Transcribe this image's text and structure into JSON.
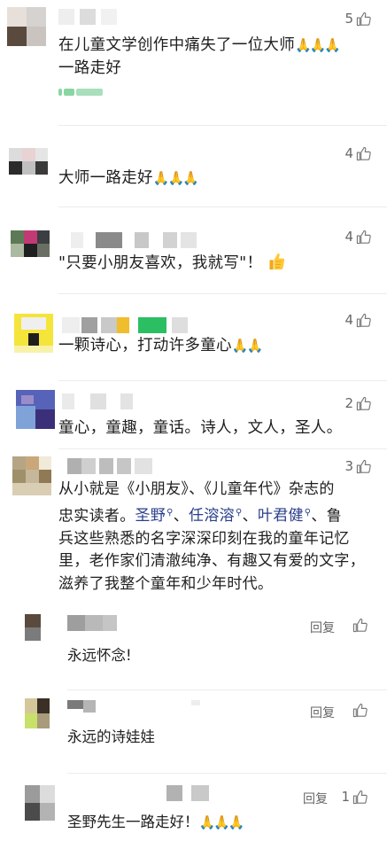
{
  "comments": [
    {
      "likes": "5",
      "text_lines": [
        "在儿童文学创作中痛失了一位大师",
        "一路走好"
      ],
      "emoji": "🙏🙏🙏"
    },
    {
      "likes": "4",
      "text": "大师一路走好",
      "emoji": "🙏🙏🙏"
    },
    {
      "likes": "4",
      "text": "\"只要小朋友喜欢，我就写\"！",
      "emoji": "👍"
    },
    {
      "likes": "4",
      "text": "一颗诗心，打动许多童心",
      "emoji": "🙏🙏"
    },
    {
      "likes": "2",
      "text": "童心，童趣，童话。诗人，文人，圣人。"
    },
    {
      "likes": "3",
      "line1": "从小就是《小朋友》、《儿童年代》杂志的",
      "line2_pre": "忠实读者。",
      "links": [
        "圣野",
        "任溶溶",
        "叶君健"
      ],
      "sep": "、",
      "line2_post": "、鲁",
      "line3": "兵这些熟悉的名字深深印刻在我的童年记忆",
      "line4": "里，老作家们清澈纯净、有趣又有爱的文字，",
      "line5": "滋养了我整个童年和少年时代。"
    }
  ],
  "replies": [
    {
      "reply_label": "回复",
      "text": "永远怀念!"
    },
    {
      "reply_label": "回复",
      "text": "永远的诗娃娃"
    },
    {
      "reply_label": "回复",
      "likes": "1",
      "text": "圣野先生一路走好！",
      "emoji": "🙏🙏🙏"
    }
  ]
}
